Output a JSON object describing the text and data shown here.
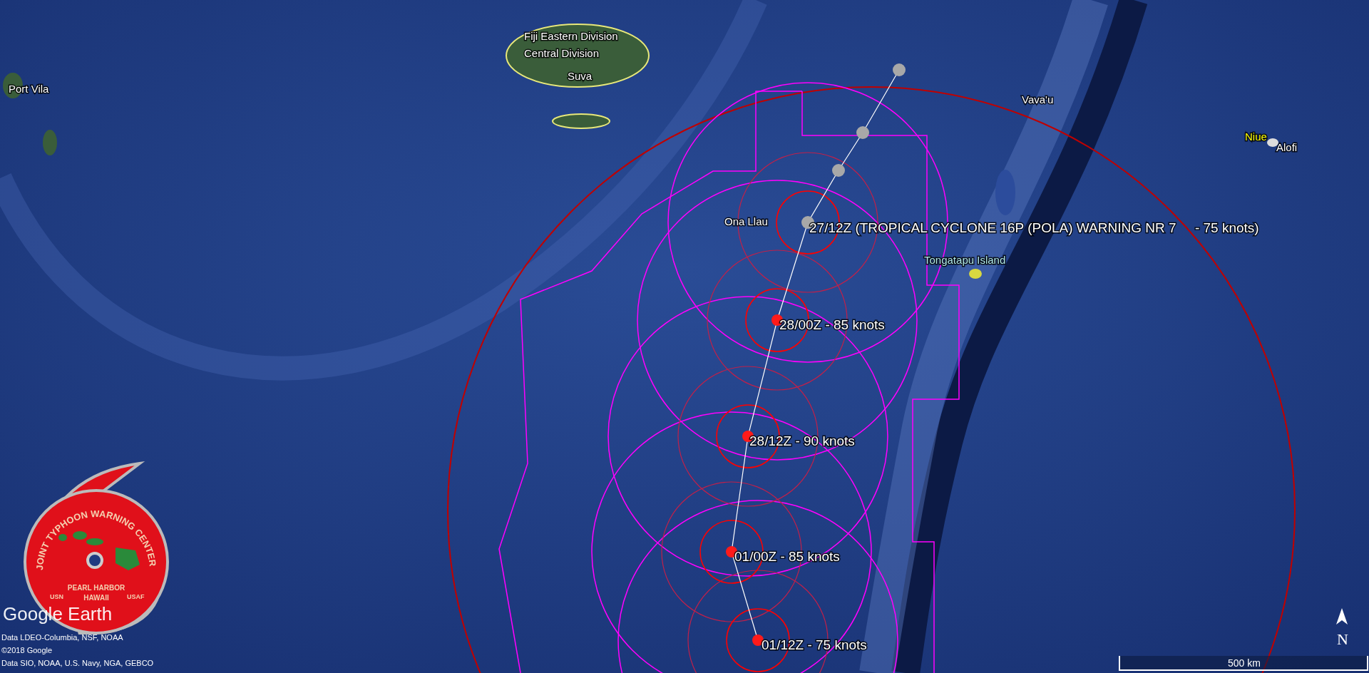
{
  "map": {
    "places": [
      {
        "label": "Port Vila",
        "color": "#ffffff"
      },
      {
        "label": "Fiji Eastern Division",
        "color": "#ffffff"
      },
      {
        "label": "Central Division",
        "color": "#ffffff"
      },
      {
        "label": "Suva",
        "color": "#ffffff"
      },
      {
        "label": "Ona Llau",
        "color": "#ffffff"
      },
      {
        "label": "Tongatapu Island",
        "color": "#aee6e6"
      },
      {
        "label": "Vava'u",
        "color": "#ffffff"
      },
      {
        "label": "Niue",
        "color": "#ffff00"
      },
      {
        "label": "Alofi",
        "color": "#ffffff"
      }
    ],
    "scale_bar": {
      "label": "500 km"
    },
    "north_label": "N"
  },
  "storm": {
    "positions": [
      {
        "kind": "past"
      },
      {
        "kind": "past"
      },
      {
        "kind": "past"
      },
      {
        "kind": "past"
      },
      {
        "kind": "forecast"
      },
      {
        "kind": "forecast"
      },
      {
        "kind": "forecast"
      },
      {
        "kind": "forecast"
      }
    ],
    "labels": [
      "27/12Z (TROPICAL CYCLONE 16P (POLA) WARNING NR 7     - 75 knots)",
      "28/00Z - 85 knots",
      "28/12Z - 90 knots",
      "01/00Z - 85 knots",
      "01/12Z - 75 knots"
    ]
  },
  "logo": {
    "ring_text": "JOINT TYPHOON WARNING CENTER",
    "place_lines": [
      "PEARL HARBOR",
      "HAWAII"
    ],
    "left_text": "USN",
    "right_text": "USAF"
  },
  "brand": "Google Earth",
  "attribution": [
    "Data LDEO-Columbia, NSF, NOAA",
    "©2018 Google",
    "Data SIO, NOAA, U.S. Navy, NGA, GEBCO"
  ]
}
